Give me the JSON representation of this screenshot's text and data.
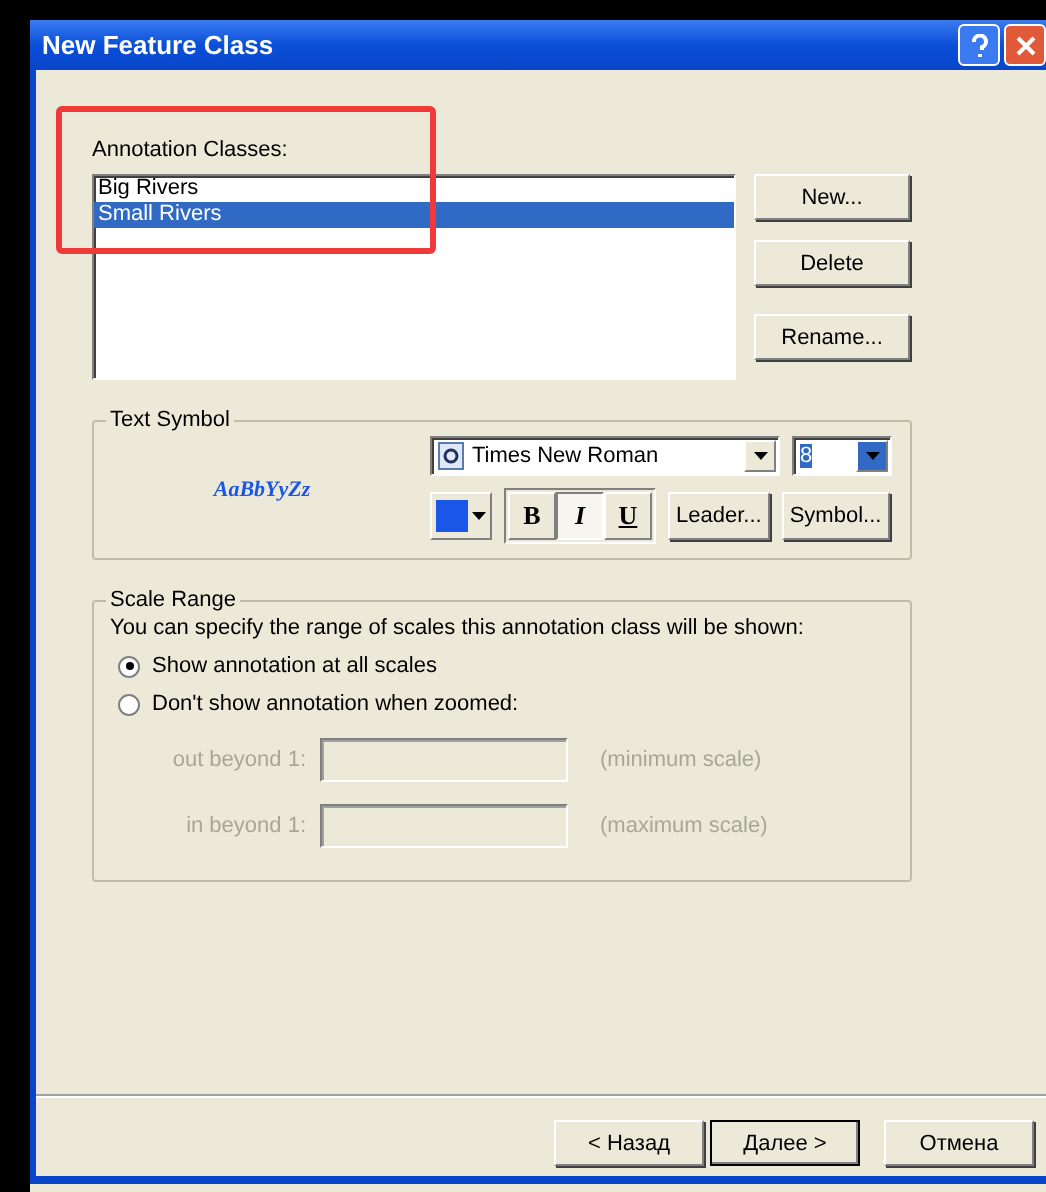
{
  "window": {
    "title": "New Feature Class"
  },
  "annotation_classes": {
    "label": "Annotation Classes:",
    "items": [
      {
        "label": "Big Rivers",
        "selected": false
      },
      {
        "label": "Small Rivers",
        "selected": true
      }
    ]
  },
  "class_buttons": [
    "New...",
    "Delete",
    "Rename..."
  ],
  "text_symbol": {
    "title": "Text Symbol",
    "sample": "AaBbYyZz",
    "font": "Times New Roman",
    "size": "8",
    "color": "#1a56e8",
    "styles": [
      {
        "label": "B",
        "kind": "bold",
        "selected": false
      },
      {
        "label": "I",
        "kind": "italic",
        "selected": true
      },
      {
        "label": "U",
        "kind": "underline",
        "selected": false
      }
    ],
    "buttons": [
      "Leader...",
      "Symbol..."
    ]
  },
  "scale_range": {
    "title": "Scale Range",
    "description": "You can specify the range of scales this annotation class will be shown:",
    "options": [
      {
        "label": "Show annotation at all scales",
        "selected": true
      },
      {
        "label": "Don't show annotation when zoomed:",
        "selected": false
      }
    ],
    "fields": [
      {
        "label": "out beyond 1:",
        "hint": "(minimum scale)",
        "disabled": true
      },
      {
        "label": "in beyond 1:",
        "hint": "(maximum scale)",
        "disabled": true
      }
    ]
  },
  "footer_buttons": [
    {
      "label": "< Назад",
      "kind": "back"
    },
    {
      "label": "Далее >",
      "kind": "default"
    },
    {
      "label": "Отмена",
      "kind": "cancel"
    }
  ]
}
